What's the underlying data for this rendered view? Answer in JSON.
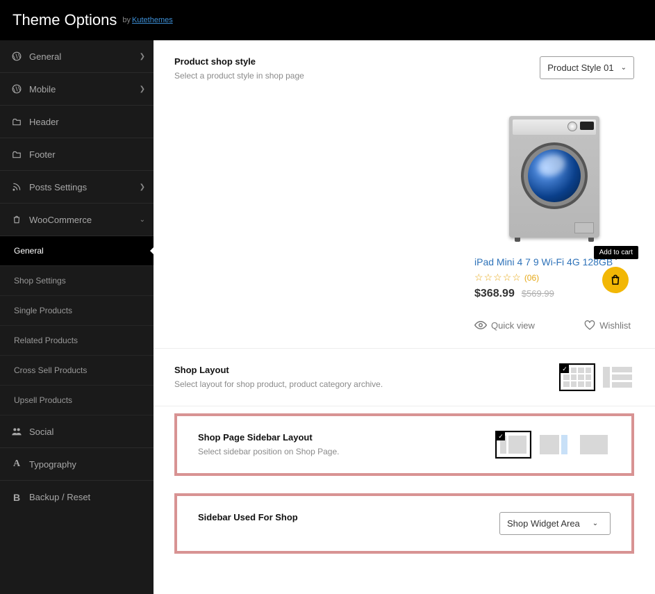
{
  "header": {
    "title": "Theme Options",
    "by": "by",
    "brand": "Kutethemes"
  },
  "sidebar": [
    {
      "icon": "wordpress",
      "label": "General",
      "chev": ">"
    },
    {
      "icon": "wordpress",
      "label": "Mobile",
      "chev": ">"
    },
    {
      "icon": "folder",
      "label": "Header"
    },
    {
      "icon": "folder",
      "label": "Footer"
    },
    {
      "icon": "rss",
      "label": "Posts Settings",
      "chev": ">"
    },
    {
      "icon": "bag",
      "label": "WooCommerce",
      "chev": "v",
      "expanded": true
    },
    {
      "sub": true,
      "label": "General",
      "active": true
    },
    {
      "sub": true,
      "label": "Shop Settings"
    },
    {
      "sub": true,
      "label": "Single Products"
    },
    {
      "sub": true,
      "label": "Related Products"
    },
    {
      "sub": true,
      "label": "Cross Sell Products"
    },
    {
      "sub": true,
      "label": "Upsell Products"
    },
    {
      "icon": "users",
      "label": "Social"
    },
    {
      "icon": "font",
      "label": "Typography"
    },
    {
      "icon": "bold",
      "label": "Backup / Reset"
    }
  ],
  "productStyle": {
    "title": "Product shop style",
    "desc": "Select a product style in shop page",
    "selected": "Product Style 01"
  },
  "product": {
    "name": "iPad Mini 4 7 9 Wi-Fi 4G 128GB",
    "reviews": "(06)",
    "price": "$368.99",
    "oldPrice": "$569.99",
    "addToCart": "Add to cart",
    "quickView": "Quick view",
    "wishlist": "Wishlist"
  },
  "shopLayout": {
    "title": "Shop Layout",
    "desc": "Select layout for shop product, product category archive."
  },
  "sidebarLayout": {
    "title": "Shop Page Sidebar Layout",
    "desc": "Select sidebar position on Shop Page."
  },
  "sidebarUsed": {
    "title": "Sidebar Used For Shop",
    "selected": "Shop Widget Area"
  }
}
